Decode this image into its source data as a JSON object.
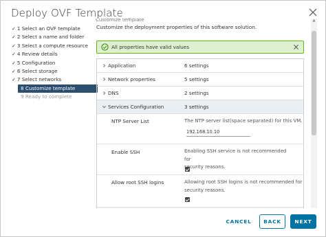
{
  "window": {
    "title": "Deploy OVF Template"
  },
  "steps": [
    {
      "label": "1 Select an OVF template",
      "state": "done"
    },
    {
      "label": "2 Select a name and folder",
      "state": "done"
    },
    {
      "label": "3 Select a compute resource",
      "state": "done"
    },
    {
      "label": "4 Review details",
      "state": "done"
    },
    {
      "label": "5 Configuration",
      "state": "done"
    },
    {
      "label": "6 Select storage",
      "state": "done"
    },
    {
      "label": "7 Select networks",
      "state": "done"
    },
    {
      "label": "8 Customize template",
      "state": "active"
    },
    {
      "label": "9 Ready to complete",
      "state": "disabled"
    }
  ],
  "main": {
    "subtitle": "Customize template",
    "description": "Customize the deployment properties of this software solution.",
    "alert": {
      "message": "All properties have valid values"
    },
    "groups": [
      {
        "name": "Application",
        "value": "6 settings"
      },
      {
        "name": "Network properties",
        "value": "5 settings"
      },
      {
        "name": "DNS",
        "value": "2 settings"
      },
      {
        "name": "Services Configuration",
        "value": "3 settings"
      }
    ],
    "properties": {
      "ntp": {
        "name": "NTP Server List",
        "description": "The NTP server list(space separated) for this VM.",
        "value": "192.168.10.10"
      },
      "ssh": {
        "name": "Enable SSH",
        "description_line1": "Enabling SSH service is not recommended for",
        "description_line2": "security reasons.",
        "checked": true
      },
      "root_ssh": {
        "name": "Allow root SSH logins",
        "description_line1": "Allowing root SSH logins is not recommended for",
        "description_line2": "security reasons.",
        "checked": true
      }
    }
  },
  "footer": {
    "cancel": "CANCEL",
    "back": "BACK",
    "next": "NEXT"
  },
  "colors": {
    "primary": "#0072a3",
    "active_step": "#2b4e6e",
    "success_bg": "#dff0d0",
    "success_border": "#60b515"
  }
}
